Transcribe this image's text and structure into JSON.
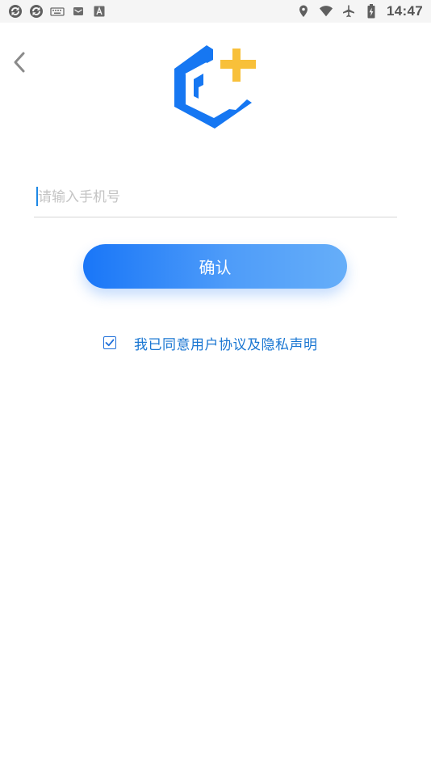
{
  "status_bar": {
    "time": "14:47",
    "left_icons": [
      "sync-icon",
      "sync-icon",
      "keyboard-icon",
      "mail-icon",
      "font-icon"
    ],
    "right_icons": [
      "location-icon",
      "wifi-icon",
      "airplane-mode-icon",
      "battery-charging-icon"
    ]
  },
  "nav": {
    "back_icon": "chevron-left-icon"
  },
  "logo": {
    "icon": "app-logo-icon",
    "colors": {
      "blue": "#1677f2",
      "yellow": "#f8c03a"
    }
  },
  "form": {
    "phone_placeholder": "请输入手机号",
    "phone_value": "",
    "confirm_label": "确认"
  },
  "agreement": {
    "checked": true,
    "text": "我已同意用户协议及隐私声明"
  },
  "colors": {
    "accent": "#1976f8",
    "link": "#1976d2",
    "input_underline": "#d6d6d6",
    "placeholder": "#c4c4c4"
  }
}
